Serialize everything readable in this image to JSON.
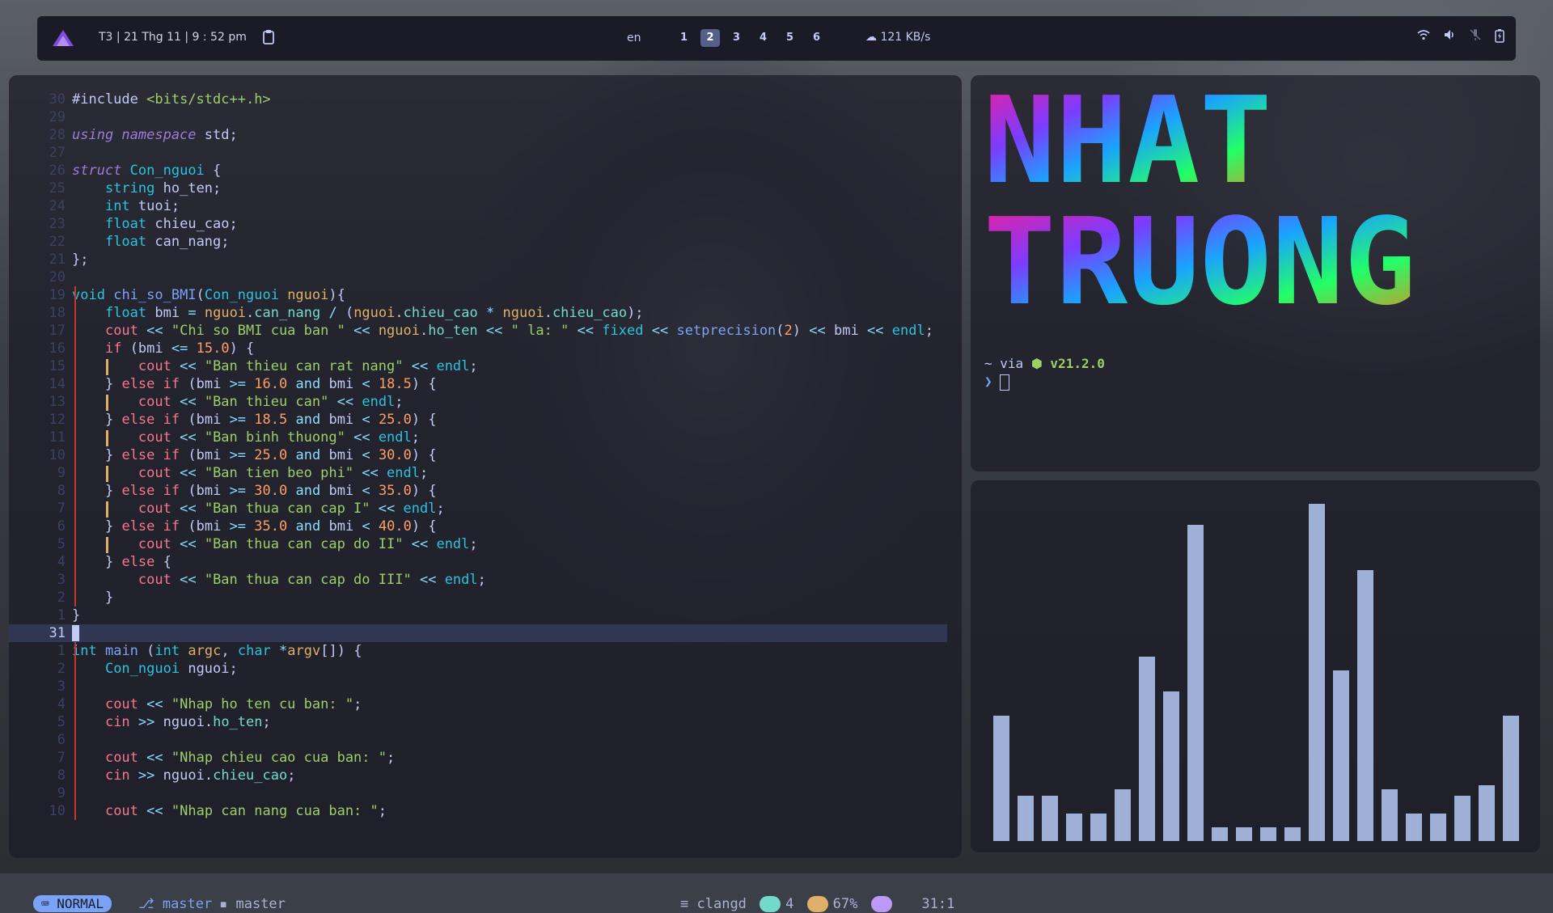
{
  "topbar": {
    "datetime": "T3 | 21 Thg 11 | 9 : 52 pm",
    "language": "en",
    "workspaces": [
      "1",
      "2",
      "3",
      "4",
      "5",
      "6"
    ],
    "active_workspace": "2",
    "network_speed": "121 KB/s"
  },
  "editor": {
    "lines": [
      {
        "n": "30",
        "html": "<span class='pl'>#include</span> <span class='st'>&lt;bits/stdc++.h&gt;</span>"
      },
      {
        "n": "29",
        "html": ""
      },
      {
        "n": "28",
        "html": "<span class='kw'>using namespace</span> <span class='pl'>std;</span>"
      },
      {
        "n": "27",
        "html": ""
      },
      {
        "n": "26",
        "html": "<span class='kw'>struct</span> <span class='ty'>Con_nguoi</span> <span class='pl'>{</span>"
      },
      {
        "n": "25",
        "html": "    <span class='ty'>string</span> <span class='pl'>ho_ten;</span>"
      },
      {
        "n": "24",
        "html": "    <span class='ty'>int</span> <span class='pl'>tuoi;</span>"
      },
      {
        "n": "23",
        "html": "    <span class='ty'>float</span> <span class='pl'>chieu_cao;</span>"
      },
      {
        "n": "22",
        "html": "    <span class='ty'>float</span> <span class='pl'>can_nang;</span>"
      },
      {
        "n": "21",
        "html": "<span class='pl'>};</span>"
      },
      {
        "n": "20",
        "html": ""
      },
      {
        "n": "19",
        "html": "<span class='ty'>void</span> <span class='fn'>chi_so_BMI</span><span class='pl'>(</span><span class='ty'>Con_nguoi</span> <span class='vr'>nguoi</span><span class='pl'>){</span>"
      },
      {
        "n": "18",
        "html": "    <span class='ty'>float</span> <span class='pl'>bmi</span> <span class='op'>=</span> <span class='vr'>nguoi</span><span class='pl'>.</span><span class='mem'>can_nang</span> <span class='op'>/</span> <span class='pl'>(</span><span class='vr'>nguoi</span><span class='pl'>.</span><span class='mem'>chieu_cao</span> <span class='op'>*</span> <span class='vr'>nguoi</span><span class='pl'>.</span><span class='mem'>chieu_cao</span><span class='pl'>);</span>"
      },
      {
        "n": "17",
        "html": "    <span class='rd'>cout</span> <span class='op'>&lt;&lt;</span> <span class='st'>\"Chi so BMI cua ban \"</span> <span class='op'>&lt;&lt;</span> <span class='vr'>nguoi</span><span class='pl'>.</span><span class='mem'>ho_ten</span> <span class='op'>&lt;&lt;</span> <span class='st'>\" la: \"</span> <span class='op'>&lt;&lt;</span> <span class='ty'>fixed</span> <span class='op'>&lt;&lt;</span> <span class='fn'>setprecision</span><span class='pl'>(</span><span class='nu'>2</span><span class='pl'>)</span> <span class='op'>&lt;&lt;</span> <span class='pl'>bmi</span> <span class='op'>&lt;&lt;</span> <span class='ty'>endl</span><span class='pl'>;</span>"
      },
      {
        "n": "16",
        "html": "    <span class='rd'>if</span> <span class='pl'>(bmi</span> <span class='op'>&lt;=</span> <span class='nu'>15.0</span><span class='pl'>) {</span>"
      },
      {
        "n": "15",
        "html": "        <span class='rd'>cout</span> <span class='op'>&lt;&lt;</span> <span class='st'>\"Ban thieu can rat nang\"</span> <span class='op'>&lt;&lt;</span> <span class='ty'>endl</span><span class='pl'>;</span>"
      },
      {
        "n": "14",
        "html": "    <span class='pl'>}</span> <span class='rd'>else if</span> <span class='pl'>(bmi</span> <span class='op'>&gt;=</span> <span class='nu'>16.0</span> <span class='op'>and</span> <span class='pl'>bmi</span> <span class='op'>&lt;</span> <span class='nu'>18.5</span><span class='pl'>) {</span>"
      },
      {
        "n": "13",
        "html": "        <span class='rd'>cout</span> <span class='op'>&lt;&lt;</span> <span class='st'>\"Ban thieu can\"</span> <span class='op'>&lt;&lt;</span> <span class='ty'>endl</span><span class='pl'>;</span>"
      },
      {
        "n": "12",
        "html": "    <span class='pl'>}</span> <span class='rd'>else if</span> <span class='pl'>(bmi</span> <span class='op'>&gt;=</span> <span class='nu'>18.5</span> <span class='op'>and</span> <span class='pl'>bmi</span> <span class='op'>&lt;</span> <span class='nu'>25.0</span><span class='pl'>) {</span>"
      },
      {
        "n": "11",
        "html": "        <span class='rd'>cout</span> <span class='op'>&lt;&lt;</span> <span class='st'>\"Ban binh thuong\"</span> <span class='op'>&lt;&lt;</span> <span class='ty'>endl</span><span class='pl'>;</span>"
      },
      {
        "n": "10",
        "html": "    <span class='pl'>}</span> <span class='rd'>else if</span> <span class='pl'>(bmi</span> <span class='op'>&gt;=</span> <span class='nu'>25.0</span> <span class='op'>and</span> <span class='pl'>bmi</span> <span class='op'>&lt;</span> <span class='nu'>30.0</span><span class='pl'>) {</span>"
      },
      {
        "n": "9",
        "html": "        <span class='rd'>cout</span> <span class='op'>&lt;&lt;</span> <span class='st'>\"Ban tien beo phi\"</span> <span class='op'>&lt;&lt;</span> <span class='ty'>endl</span><span class='pl'>;</span>"
      },
      {
        "n": "8",
        "html": "    <span class='pl'>}</span> <span class='rd'>else if</span> <span class='pl'>(bmi</span> <span class='op'>&gt;=</span> <span class='nu'>30.0</span> <span class='op'>and</span> <span class='pl'>bmi</span> <span class='op'>&lt;</span> <span class='nu'>35.0</span><span class='pl'>) {</span>"
      },
      {
        "n": "7",
        "html": "        <span class='rd'>cout</span> <span class='op'>&lt;&lt;</span> <span class='st'>\"Ban thua can cap I\"</span> <span class='op'>&lt;&lt;</span> <span class='ty'>endl</span><span class='pl'>;</span>"
      },
      {
        "n": "6",
        "html": "    <span class='pl'>}</span> <span class='rd'>else if</span> <span class='pl'>(bmi</span> <span class='op'>&gt;=</span> <span class='nu'>35.0</span> <span class='op'>and</span> <span class='pl'>bmi</span> <span class='op'>&lt;</span> <span class='nu'>40.0</span><span class='pl'>) {</span>"
      },
      {
        "n": "5",
        "html": "        <span class='rd'>cout</span> <span class='op'>&lt;&lt;</span> <span class='st'>\"Ban thua can cap do II\"</span> <span class='op'>&lt;&lt;</span> <span class='ty'>endl</span><span class='pl'>;</span>"
      },
      {
        "n": "4",
        "html": "    <span class='pl'>}</span> <span class='rd'>else</span> <span class='pl'>{</span>"
      },
      {
        "n": "3",
        "html": "        <span class='rd'>cout</span> <span class='op'>&lt;&lt;</span> <span class='st'>\"Ban thua can cap do III\"</span> <span class='op'>&lt;&lt;</span> <span class='ty'>endl</span><span class='pl'>;</span>"
      },
      {
        "n": "2",
        "html": "    <span class='pl'>}</span>"
      },
      {
        "n": "1",
        "html": "<span class='pl'>}</span>"
      },
      {
        "n": "31",
        "html": "",
        "cur": true
      },
      {
        "n": "1",
        "html": "<span class='ty'>int</span> <span class='fn'>main</span> <span class='pl'>(</span><span class='ty'>int</span> <span class='vr'>argc</span><span class='pl'>,</span> <span class='ty'>char</span> <span class='op'>*</span><span class='vr'>argv</span><span class='pl'>[]) {</span>"
      },
      {
        "n": "2",
        "html": "    <span class='ty'>Con_nguoi</span> <span class='pl'>nguoi;</span>"
      },
      {
        "n": "3",
        "html": ""
      },
      {
        "n": "4",
        "html": "    <span class='rd'>cout</span> <span class='op'>&lt;&lt;</span> <span class='st'>\"Nhap ho ten cu ban: \"</span><span class='pl'>;</span>"
      },
      {
        "n": "5",
        "html": "    <span class='rd'>cin</span> <span class='op'>&gt;&gt;</span> <span class='pl'>nguoi.</span><span class='mem'>ho_ten</span><span class='pl'>;</span>"
      },
      {
        "n": "6",
        "html": ""
      },
      {
        "n": "7",
        "html": "    <span class='rd'>cout</span> <span class='op'>&lt;&lt;</span> <span class='st'>\"Nhap chieu cao cua ban: \"</span><span class='pl'>;</span>"
      },
      {
        "n": "8",
        "html": "    <span class='rd'>cin</span> <span class='op'>&gt;&gt;</span> <span class='pl'>nguoi.</span><span class='mem'>chieu_cao</span><span class='pl'>;</span>"
      },
      {
        "n": "9",
        "html": ""
      },
      {
        "n": "10",
        "html": "    <span class='rd'>cout</span> <span class='op'>&lt;&lt;</span> <span class='st'>\"Nhap can nang cua ban: \"</span><span class='pl'>;</span>"
      }
    ]
  },
  "statusline": {
    "mode": "NORMAL",
    "branch_a": "master",
    "branch_b": "master",
    "lsp": "clangd",
    "diag_count": "4",
    "percent": "67%",
    "position": "31:1"
  },
  "terminal": {
    "banner_line1": "NHAT",
    "banner_line2": "TRUONG",
    "prompt_prefix": "~ via",
    "node_version": "v21.2.0",
    "prompt_char": "❯"
  },
  "visualizer": {
    "bar_color": "#9fb0d8",
    "levels": [
      0.36,
      0.13,
      0.13,
      0.08,
      0.08,
      0.15,
      0.53,
      0.43,
      0.91,
      0.04,
      0.04,
      0.04,
      0.04,
      0.97,
      0.49,
      0.78,
      0.15,
      0.08,
      0.08,
      0.13,
      0.16,
      0.36
    ]
  },
  "colors": {
    "bar_bg": "#1a1b26",
    "accent": "#7aa2f7"
  }
}
